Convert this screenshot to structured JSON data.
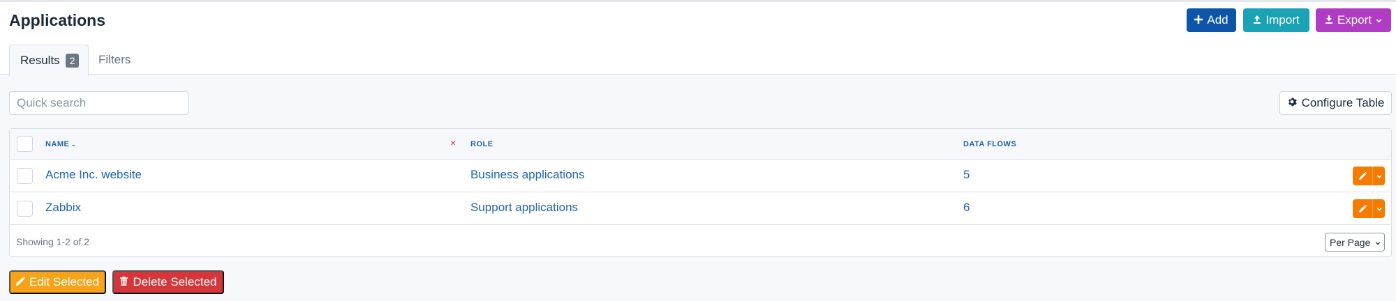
{
  "page": {
    "title": "Applications"
  },
  "header_actions": {
    "add": "Add",
    "import": "Import",
    "export": "Export"
  },
  "tabs": {
    "results": "Results",
    "results_count": "2",
    "filters": "Filters"
  },
  "search": {
    "placeholder": "Quick search",
    "value": ""
  },
  "toolbar": {
    "configure_table": "Configure Table"
  },
  "table": {
    "columns": {
      "name": "NAME",
      "role": "ROLE",
      "data_flows": "DATA FLOWS"
    },
    "clear_symbol": "×",
    "rows": [
      {
        "name": "Acme Inc. website",
        "role": "Business applications",
        "data_flows": "5"
      },
      {
        "name": "Zabbix",
        "role": "Support applications",
        "data_flows": "6"
      }
    ],
    "showing": "Showing 1-2 of 2",
    "per_page": "Per Page"
  },
  "bulk_actions": {
    "edit_selected": "Edit Selected",
    "delete_selected": "Delete Selected"
  },
  "colors": {
    "primary": "#0d55a8",
    "info": "#1aa3b5",
    "purple": "#b03cc4",
    "warning": "#f7a318",
    "orange": "#f57c00",
    "danger": "#d6363a",
    "link": "#1f64b5"
  },
  "icons": {
    "add": "plus-icon",
    "import": "upload-icon",
    "export": "download-icon",
    "configure": "gear-icon",
    "row_edit": "pencil-icon",
    "delete": "trash-icon"
  }
}
